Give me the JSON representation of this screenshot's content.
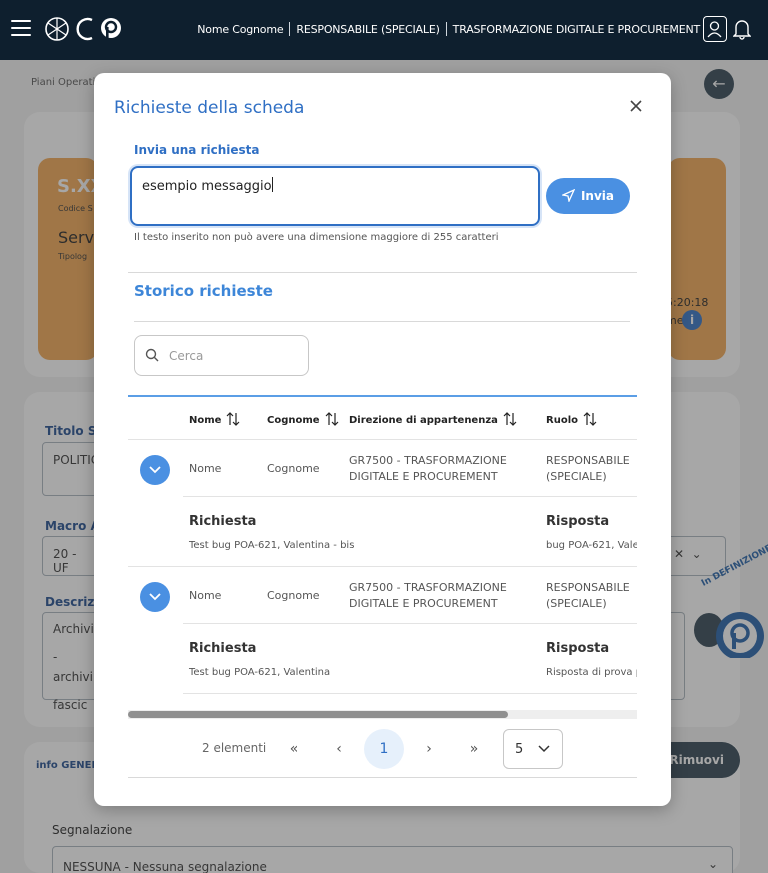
{
  "header": {
    "user_name": "Nome Cognome",
    "role": "RESPONSABILE (SPECIALE)",
    "department": "TRASFORMAZIONE DIGITALE E PROCUREMENT"
  },
  "background": {
    "breadcrumb": "Piani Operati",
    "card_code": "S.XX",
    "card_code_label": "Codice S",
    "card_title": "Servi",
    "card_type": "Tipolog",
    "card_time": "5:20:18",
    "card_extra": "me",
    "title_label": "Titolo Sc",
    "title_value": "POLITIC",
    "macro_label": "Macro A",
    "macro_value": "20 - UF",
    "desc_label": "Descrizi",
    "desc_line1": "Archivio",
    "desc_line2": "- archivi",
    "desc_line3": "  fascic",
    "info_label": "info GENER",
    "remove_label": "Rimuovi",
    "status_text": "In DEFINIZIONE",
    "segnalazione_label": "Segnalazione",
    "segnalazione_value": "NESSUNA - Nessuna segnalazione"
  },
  "modal": {
    "title": "Richieste della scheda",
    "send_label": "Invia una richiesta",
    "message_value": "esempio messaggio",
    "send_button": "Invia",
    "hint": "Il testo inserito non può avere una dimensione maggiore di 255 caratteri",
    "history_title": "Storico richieste",
    "search_placeholder": "Cerca",
    "columns": [
      "Nome",
      "Cognome",
      "Direzione di appartenenza",
      "Ruolo"
    ],
    "rows": [
      {
        "nome": "Nome",
        "cognome": "Cognome",
        "direzione_1": "GR7500 - TRASFORMAZIONE",
        "direzione_2": "DIGITALE E PROCUREMENT",
        "ruolo_1": "RESPONSABILE",
        "ruolo_2": "(SPECIALE)",
        "richiesta_label": "Richiesta",
        "richiesta": "Test bug POA-621, Valentina - bis",
        "risposta_label": "Risposta",
        "risposta": "bug POA-621, Vale"
      },
      {
        "nome": "Nome",
        "cognome": "Cognome",
        "direzione_1": "GR7500 - TRASFORMAZIONE",
        "direzione_2": "DIGITALE E PROCUREMENT",
        "ruolo_1": "RESPONSABILE",
        "ruolo_2": "(SPECIALE)",
        "richiesta_label": "Richiesta",
        "richiesta": "Test bug POA-621, Valentina",
        "risposta_label": "Risposta",
        "risposta": "Risposta di prova p"
      }
    ],
    "pagination": {
      "count": "2 elementi",
      "first": "«",
      "prev": "‹",
      "page": "1",
      "next": "›",
      "last": "»",
      "page_size": "5"
    }
  }
}
